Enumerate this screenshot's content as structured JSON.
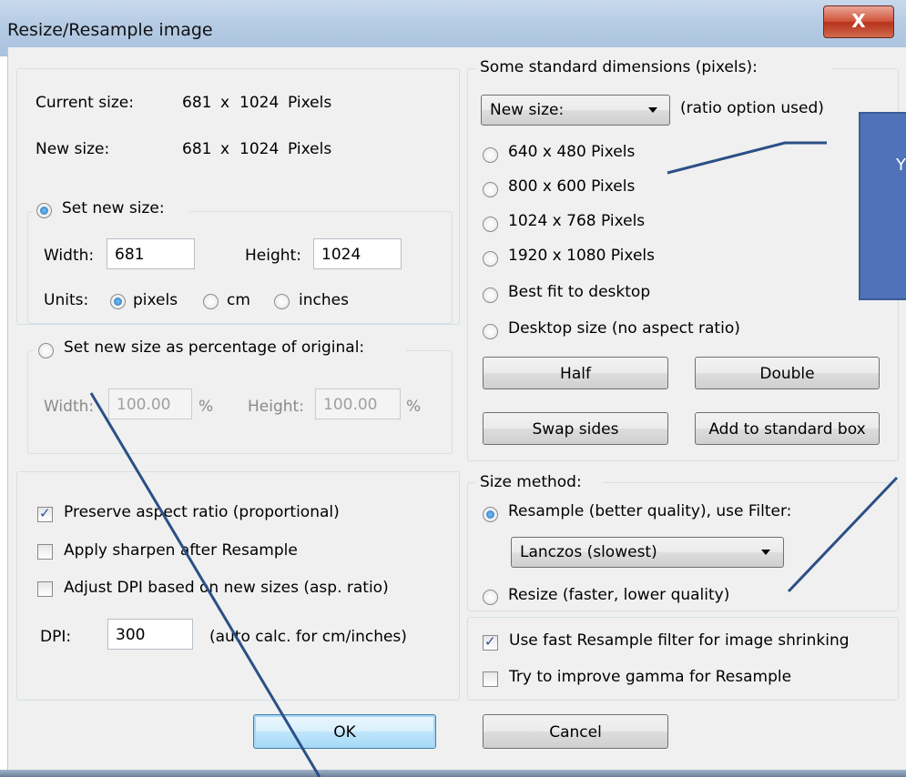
{
  "window": {
    "title": "Resize/Resample image",
    "close_label": "X"
  },
  "current_size": {
    "label": "Current size:",
    "width": "681",
    "x": "x",
    "height": "1024",
    "unit": "Pixels"
  },
  "new_size": {
    "label": "New size:",
    "width": "681",
    "x": "x",
    "height": "1024",
    "unit": "Pixels"
  },
  "set_new_size": {
    "label": "Set new size:",
    "selected": true,
    "width_label": "Width:",
    "width_value": "681",
    "height_label": "Height:",
    "height_value": "1024",
    "units_label": "Units:",
    "units": [
      {
        "label": "pixels",
        "selected": true
      },
      {
        "label": "cm",
        "selected": false
      },
      {
        "label": "inches",
        "selected": false
      }
    ]
  },
  "percentage": {
    "label": "Set new size as percentage of original:",
    "selected": false,
    "width_label": "Width:",
    "width_value": "100.00",
    "width_unit": "%",
    "height_label": "Height:",
    "height_value": "100.00",
    "height_unit": "%"
  },
  "options": {
    "preserve": {
      "label": "Preserve aspect ratio (proportional)",
      "checked": true
    },
    "sharpen": {
      "label": "Apply sharpen after Resample",
      "checked": false
    },
    "dpi_adjust": {
      "label": "Adjust DPI based on new sizes (asp. ratio)",
      "checked": false
    },
    "dpi_label": "DPI:",
    "dpi_value": "300",
    "dpi_hint": "(auto calc. for cm/inches)"
  },
  "standard": {
    "title": "Some standard dimensions (pixels):",
    "combo_value": "New size:",
    "combo_hint": "(ratio option used)",
    "options": [
      {
        "label": "640 x 480 Pixels"
      },
      {
        "label": "800 x 600 Pixels"
      },
      {
        "label": "1024 x 768 Pixels"
      },
      {
        "label": "1920 x 1080 Pixels"
      },
      {
        "label": "Best fit to desktop"
      },
      {
        "label": "Desktop size (no aspect ratio)"
      }
    ],
    "half": "Half",
    "double": "Double",
    "swap": "Swap sides",
    "add": "Add to standard box"
  },
  "size_method": {
    "title": "Size method:",
    "resample": {
      "label": "Resample (better quality), use Filter:",
      "selected": true
    },
    "filter_value": "Lanczos (slowest)",
    "resize": {
      "label": "Resize (faster, lower quality)",
      "selected": false
    },
    "fast_filter": {
      "label": "Use fast Resample filter for image shrinking",
      "checked": true
    },
    "gamma": {
      "label": "Try to improve gamma for Resample",
      "checked": false
    }
  },
  "buttons": {
    "ok": "OK",
    "cancel": "Cancel"
  },
  "callout": {
    "text": "Y"
  },
  "colors": {
    "callout": "#4f72b8",
    "annotation_line": "#2b4f86",
    "radio_selected": "#1c6fc4"
  }
}
